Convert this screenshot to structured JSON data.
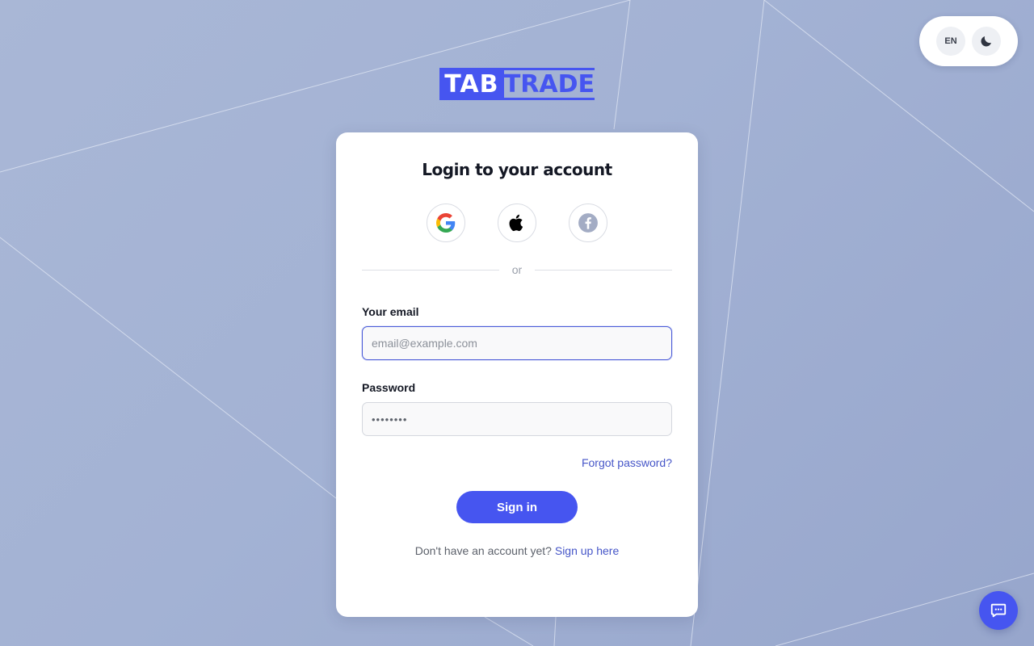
{
  "header": {
    "language_label": "EN",
    "theme_toggle_icon": "moon-icon"
  },
  "logo": {
    "part1": "TAB",
    "part2": "TRADE",
    "brand_color": "#4655f0"
  },
  "login": {
    "title": "Login to your account",
    "social": [
      {
        "name": "google-icon"
      },
      {
        "name": "apple-icon"
      },
      {
        "name": "facebook-icon"
      }
    ],
    "divider_text": "or",
    "email_label": "Your email",
    "email_placeholder": "email@example.com",
    "email_value": "",
    "password_label": "Password",
    "password_placeholder": "••••••••",
    "password_value": "",
    "forgot_password": "Forgot password?",
    "submit_label": "Sign in",
    "signup_prompt": "Don't have an account yet?",
    "signup_link": "Sign up here"
  },
  "chat": {
    "icon": "chat-bubble-icon"
  },
  "colors": {
    "accent": "#4655f0",
    "link": "#4656c8",
    "focus_border": "#4a5bd8"
  }
}
